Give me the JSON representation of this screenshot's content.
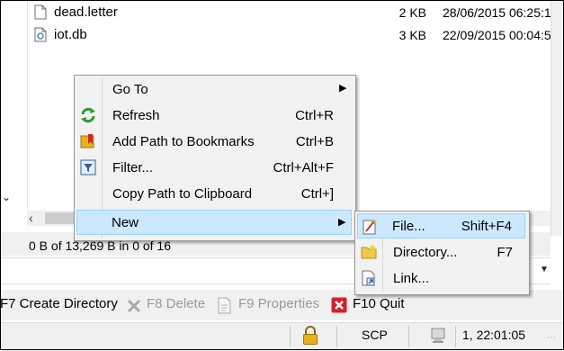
{
  "files": [
    {
      "name": "dead.letter",
      "size": "2 KB",
      "date": "28/06/2015 06:25:1",
      "icon": "text-file-icon"
    },
    {
      "name": "iot.db",
      "size": "3 KB",
      "date": "22/09/2015 00:04:5",
      "icon": "database-file-icon"
    }
  ],
  "status": "0 B of 13,269 B in 0 of 16",
  "context_menu": {
    "items": [
      {
        "label": "Go To",
        "shortcut": "",
        "has_submenu": true,
        "icon": ""
      },
      {
        "label": "Refresh",
        "shortcut": "Ctrl+R",
        "icon": "refresh-icon"
      },
      {
        "label": "Add Path to Bookmarks",
        "shortcut": "Ctrl+B",
        "icon": "bookmark-icon"
      },
      {
        "label": "Filter...",
        "shortcut": "Ctrl+Alt+F",
        "icon": "filter-icon"
      },
      {
        "label": "Copy Path to Clipboard",
        "shortcut": "Ctrl+]",
        "icon": ""
      },
      {
        "label": "New",
        "shortcut": "",
        "has_submenu": true,
        "highlighted": true,
        "icon": ""
      }
    ]
  },
  "submenu": {
    "items": [
      {
        "label": "File...",
        "shortcut": "Shift+F4",
        "highlighted": true,
        "icon": "new-file-icon"
      },
      {
        "label": "Directory...",
        "shortcut": "F7",
        "icon": "new-folder-icon"
      },
      {
        "label": "Link...",
        "shortcut": "",
        "icon": "link-icon"
      }
    ]
  },
  "function_keys": [
    {
      "label": "F7 Create Directory",
      "enabled": true
    },
    {
      "label": "F8 Delete",
      "enabled": false
    },
    {
      "label": "F9 Properties",
      "enabled": false
    },
    {
      "label": "F10 Quit",
      "enabled": true
    }
  ],
  "statusbar": {
    "protocol": "SCP",
    "time": "1, 22:01:05"
  },
  "colors": {
    "highlight_bg": "#cce8ff",
    "highlight_border": "#99d1ff",
    "menu_bg": "#f2f2f2",
    "quit_red": "#d4202b",
    "lock_yellow": "#e8b11a"
  }
}
